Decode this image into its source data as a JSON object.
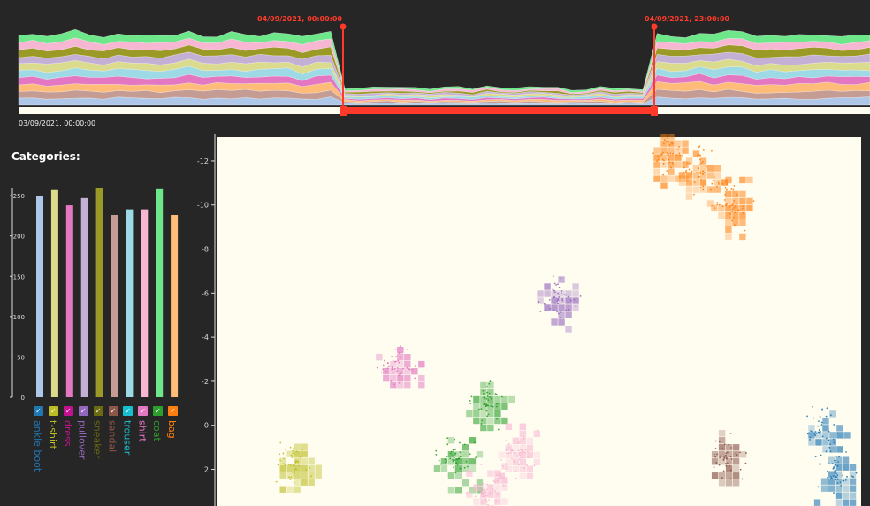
{
  "timeline": {
    "range_start_label": "04/09/2021, 00:00:00",
    "range_end_label": "04/09/2021, 23:00:00",
    "axis_start_label": "03/09/2021, 00:00:00",
    "handle_color": "#ff3a2a"
  },
  "categories_title": "Categories:",
  "categories": [
    {
      "name": "ankle boot",
      "color": "#aec7e8",
      "box": "#1f77b4",
      "count": 250
    },
    {
      "name": "t-shirt",
      "color": "#dbdb8d",
      "box": "#bcbd22",
      "count": 257
    },
    {
      "name": "dress",
      "color": "#e377c2",
      "box": "#c5118f",
      "count": 238
    },
    {
      "name": "pullover",
      "color": "#c5b0d5",
      "box": "#9467bd",
      "count": 247
    },
    {
      "name": "sneaker",
      "color": "#9c9a27",
      "box": "#6b6b10",
      "count": 259
    },
    {
      "name": "sandal",
      "color": "#c49c94",
      "box": "#8c564b",
      "count": 226
    },
    {
      "name": "trouser",
      "color": "#9edae5",
      "box": "#17becf",
      "count": 233
    },
    {
      "name": "shirt",
      "color": "#f7b6d2",
      "box": "#e377c2",
      "count": 233
    },
    {
      "name": "coat",
      "color": "#6ee78a",
      "box": "#2ca02c",
      "count": 258
    },
    {
      "name": "bag",
      "color": "#ffbb78",
      "box": "#ff7f0e",
      "count": 226
    }
  ],
  "chart_data": [
    {
      "type": "bar",
      "categories": [
        "ankle boot",
        "t-shirt",
        "dress",
        "pullover",
        "sneaker",
        "sandal",
        "trouser",
        "shirt",
        "coat",
        "bag"
      ],
      "values": [
        250,
        257,
        238,
        247,
        259,
        226,
        233,
        233,
        258,
        226
      ],
      "ylim": [
        0,
        260
      ],
      "yticks": [
        "0",
        "50",
        "100",
        "150",
        "200",
        "250"
      ]
    },
    {
      "type": "scatter",
      "yticks": [
        "-12",
        "-10",
        "-8",
        "-6",
        "-4",
        "-2",
        "0",
        "2"
      ],
      "series": [
        {
          "color": "#ff7f0e",
          "clusters": [
            {
              "x": 0.7,
              "y": -12.3
            },
            {
              "x": 0.75,
              "y": -11.5
            },
            {
              "x": 0.8,
              "y": -10.0
            }
          ]
        },
        {
          "color": "#9467bd",
          "clusters": [
            {
              "x": 0.53,
              "y": -5.8
            }
          ]
        },
        {
          "color": "#e377c2",
          "clusters": [
            {
              "x": 0.28,
              "y": -2.6
            }
          ]
        },
        {
          "color": "#2ca02c",
          "clusters": [
            {
              "x": 0.42,
              "y": -1.0
            },
            {
              "x": 0.37,
              "y": 1.5
            }
          ]
        },
        {
          "color": "#bcbd22",
          "clusters": [
            {
              "x": 0.12,
              "y": 1.8
            }
          ]
        },
        {
          "color": "#f7b6d2",
          "clusters": [
            {
              "x": 0.47,
              "y": 1.2
            },
            {
              "x": 0.42,
              "y": 3.0
            }
          ]
        },
        {
          "color": "#8c564b",
          "clusters": [
            {
              "x": 0.79,
              "y": 1.5
            }
          ]
        },
        {
          "color": "#1f77b4",
          "clusters": [
            {
              "x": 0.94,
              "y": 0.3
            },
            {
              "x": 0.96,
              "y": 2.4
            }
          ]
        }
      ]
    }
  ]
}
